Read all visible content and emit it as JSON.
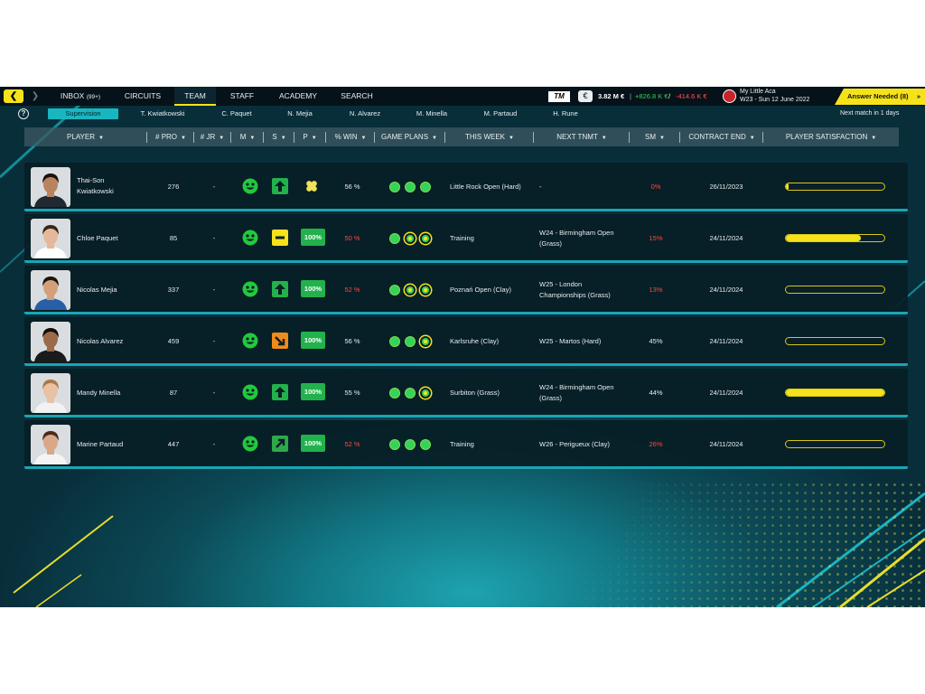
{
  "topbar": {
    "tabs": [
      {
        "label": "INBOX",
        "badge": "(99+)"
      },
      {
        "label": "CIRCUITS"
      },
      {
        "label": "TEAM"
      },
      {
        "label": "STAFF"
      },
      {
        "label": "ACADEMY"
      },
      {
        "label": "SEARCH"
      }
    ],
    "active_tab": "TEAM",
    "logo_text": "TM",
    "finance": {
      "balance": "3.82 M €",
      "income": "+826.8 K €",
      "separator": "/",
      "expense": "-414.6 K €"
    },
    "club": {
      "name": "My Little Aca",
      "date": "W23 - Sun 12 June 2022"
    },
    "answer_button": "Answer Needed (8)",
    "next_match": "Next match in 1 days"
  },
  "subtabs": [
    "Supervision",
    "T. Kwiatkowski",
    "C. Paquet",
    "N. Mejia",
    "N. Alvarez",
    "M. Minella",
    "M. Partaud",
    "H. Rune"
  ],
  "active_subtab": "Supervision",
  "columns": [
    "PLAYER",
    "# PRO",
    "# JR",
    "M",
    "S",
    "P",
    "% WIN",
    "GAME PLANS",
    "THIS WEEK",
    "NEXT TNMT",
    "SM",
    "CONTRACT END",
    "PLAYER SATISFACTION"
  ],
  "players": [
    {
      "name": "Thai-Son Kwiatkowski",
      "name_l1": "Thai-Son",
      "name_l2": "Kwiatkowski",
      "pro": "276",
      "jr": "-",
      "trend": "up",
      "p": "",
      "p_icon": "cross",
      "win": "56 %",
      "win_red": false,
      "plans": [
        "full",
        "full",
        "full"
      ],
      "this_week": "Little Rock Open (Hard)",
      "next_l1": "-",
      "next_l2": "",
      "sm": "0%",
      "sm_red": true,
      "contract": "26/11/2023",
      "satisfaction": 0.03,
      "skin": "#b9835d",
      "hair": "#1b120c",
      "shirt": "#222831"
    },
    {
      "name": "Chloe Paquet",
      "name_l1": "Chloe Paquet",
      "name_l2": "",
      "pro": "85",
      "jr": "-",
      "trend": "flat",
      "p": "100%",
      "p_icon": "",
      "win": "50 %",
      "win_red": true,
      "plans": [
        "full",
        "ring",
        "ring"
      ],
      "this_week": "Training",
      "next_l1": "W24 - Birmingham Open",
      "next_l2": "(Grass)",
      "sm": "15%",
      "sm_red": true,
      "contract": "24/11/2024",
      "satisfaction": 0.76,
      "skin": "#e6b89a",
      "hair": "#3a2418",
      "shirt": "#ffffff"
    },
    {
      "name": "Nicolas Mejia",
      "name_l1": "Nicolas Mejia",
      "name_l2": "",
      "pro": "337",
      "jr": "-",
      "trend": "up",
      "p": "100%",
      "p_icon": "",
      "win": "52 %",
      "win_red": true,
      "plans": [
        "full",
        "ring",
        "ring"
      ],
      "this_week": "Poznań Open (Clay)",
      "next_l1": "W25 - London",
      "next_l2": "Championships (Grass)",
      "sm": "13%",
      "sm_red": true,
      "contract": "24/11/2024",
      "satisfaction": 0.0,
      "skin": "#d4a07c",
      "hair": "#1e140e",
      "shirt": "#2a5fa8"
    },
    {
      "name": "Nicolas Alvarez",
      "name_l1": "Nicolas Alvarez",
      "name_l2": "",
      "pro": "459",
      "jr": "-",
      "trend": "down-right",
      "p": "100%",
      "p_icon": "",
      "win": "56 %",
      "win_red": false,
      "plans": [
        "full",
        "full",
        "ring"
      ],
      "this_week": "Karlsruhe (Clay)",
      "next_l1": "W25 -  Martos (Hard)",
      "next_l2": "",
      "sm": "45%",
      "sm_red": false,
      "contract": "24/11/2024",
      "satisfaction": 0.0,
      "skin": "#9c6a48",
      "hair": "#140d08",
      "shirt": "#1a1a1a"
    },
    {
      "name": "Mandy Minella",
      "name_l1": "Mandy Minella",
      "name_l2": "",
      "pro": "87",
      "jr": "-",
      "trend": "up",
      "p": "100%",
      "p_icon": "",
      "win": "55 %",
      "win_red": false,
      "plans": [
        "full",
        "full",
        "ring"
      ],
      "this_week": "Surbiton (Grass)",
      "next_l1": "W24 - Birmingham Open",
      "next_l2": "(Grass)",
      "sm": "44%",
      "sm_red": false,
      "contract": "24/11/2024",
      "satisfaction": 1.0,
      "skin": "#e9c1a3",
      "hair": "#a97a4a",
      "shirt": "#f2f2f2"
    },
    {
      "name": "Marine Partaud",
      "name_l1": "Marine Partaud",
      "name_l2": "",
      "pro": "447",
      "jr": "-",
      "trend": "up-right",
      "p": "100%",
      "p_icon": "",
      "win": "52 %",
      "win_red": true,
      "plans": [
        "full",
        "full",
        "full"
      ],
      "this_week": "Training",
      "next_l1": "W26 -  Perigueux (Clay)",
      "next_l2": "",
      "sm": "26%",
      "sm_red": true,
      "contract": "24/11/2024",
      "satisfaction": 0.0,
      "skin": "#d9a888",
      "hair": "#4a2a1a",
      "shirt": "#f4f4f4"
    }
  ]
}
